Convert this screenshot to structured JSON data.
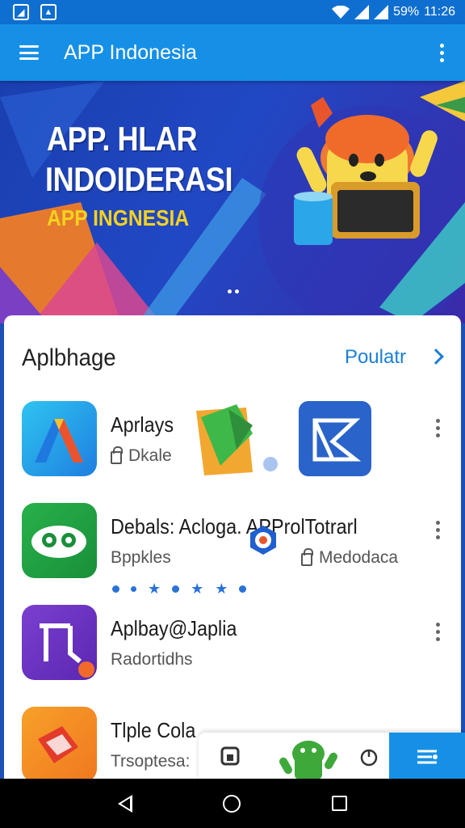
{
  "status_bar": {
    "battery": "59%",
    "time": "11:26"
  },
  "app_bar": {
    "title": "APP Indonesia"
  },
  "hero": {
    "title_line1": "APP. HLAR",
    "title_line2": "INDOIDERASI",
    "subtitle": "APP INGNESIA"
  },
  "section": {
    "title": "Aplbhage",
    "see_all": "Poulatr"
  },
  "apps": [
    {
      "name": "Aprlays",
      "sub": "Dkale"
    },
    {
      "name": "Debals: Acloga. APProlTotrarl",
      "sub": "Bppkles",
      "sub2": "Medodaca"
    },
    {
      "name": "Aplbay@Japlia",
      "sub": "Radortidhs"
    },
    {
      "name": "Tlple Cola",
      "sub": "Trsoptesa:"
    }
  ],
  "colors": {
    "status_bar": "#0f6fd0",
    "app_bar": "#1690e6",
    "accent": "#1a7fd6",
    "hero_yellow": "#f4d21f"
  }
}
